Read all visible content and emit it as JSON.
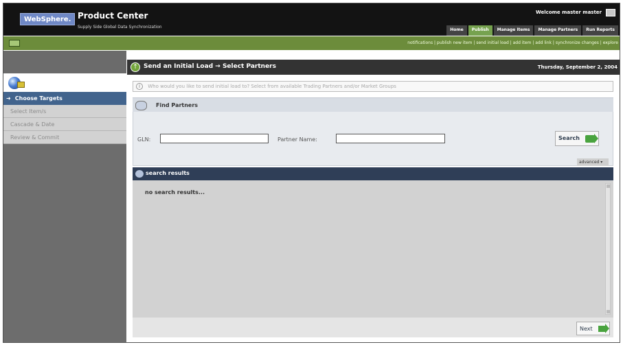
{
  "header": {
    "brand": "WebSphere.",
    "product": "Product Center",
    "subtitle": "Supply Side Global Data Synchronization",
    "welcome": "Welcome master master",
    "tabs": [
      {
        "label": "Home",
        "active": false
      },
      {
        "label": "Publish",
        "active": true
      },
      {
        "label": "Manage Items",
        "active": false
      },
      {
        "label": "Manage Partners",
        "active": false
      },
      {
        "label": "Run Reports",
        "active": false
      }
    ]
  },
  "quick_links": "notifications | publish new item | send initial load | add item | add link | synchronize changes | explore",
  "sidebar": {
    "steps": [
      {
        "label": "Choose Targets",
        "active": true
      },
      {
        "label": "Select Item/s",
        "active": false
      },
      {
        "label": "Cascade & Date",
        "active": false
      },
      {
        "label": "Review & Commit",
        "active": false
      }
    ]
  },
  "page": {
    "title": "Send an Initial Load → Select Partners",
    "date": "Thursday, September 2, 2004",
    "question": "Who would you like to send initial load to? Select from available Trading Partners and/or Market Groups"
  },
  "find_partners": {
    "label": "Find Partners",
    "gln_label": "GLN:",
    "gln_value": "",
    "partner_name_label": "Partner Name:",
    "partner_name_value": "",
    "search_label": "Search",
    "advanced_label": "advanced"
  },
  "results": {
    "header": "search results",
    "empty_text": "no search results..."
  },
  "footer": {
    "next_label": "Next"
  },
  "icon_names": {
    "user": "user-icon",
    "green_nav": "green-nav-icon",
    "globe": "globe-icon",
    "info": "info-icon",
    "find": "find-partners-icon",
    "results": "search-results-icon",
    "search_arrow": "search-arrow-icon",
    "next_arrow": "next-arrow-icon"
  }
}
